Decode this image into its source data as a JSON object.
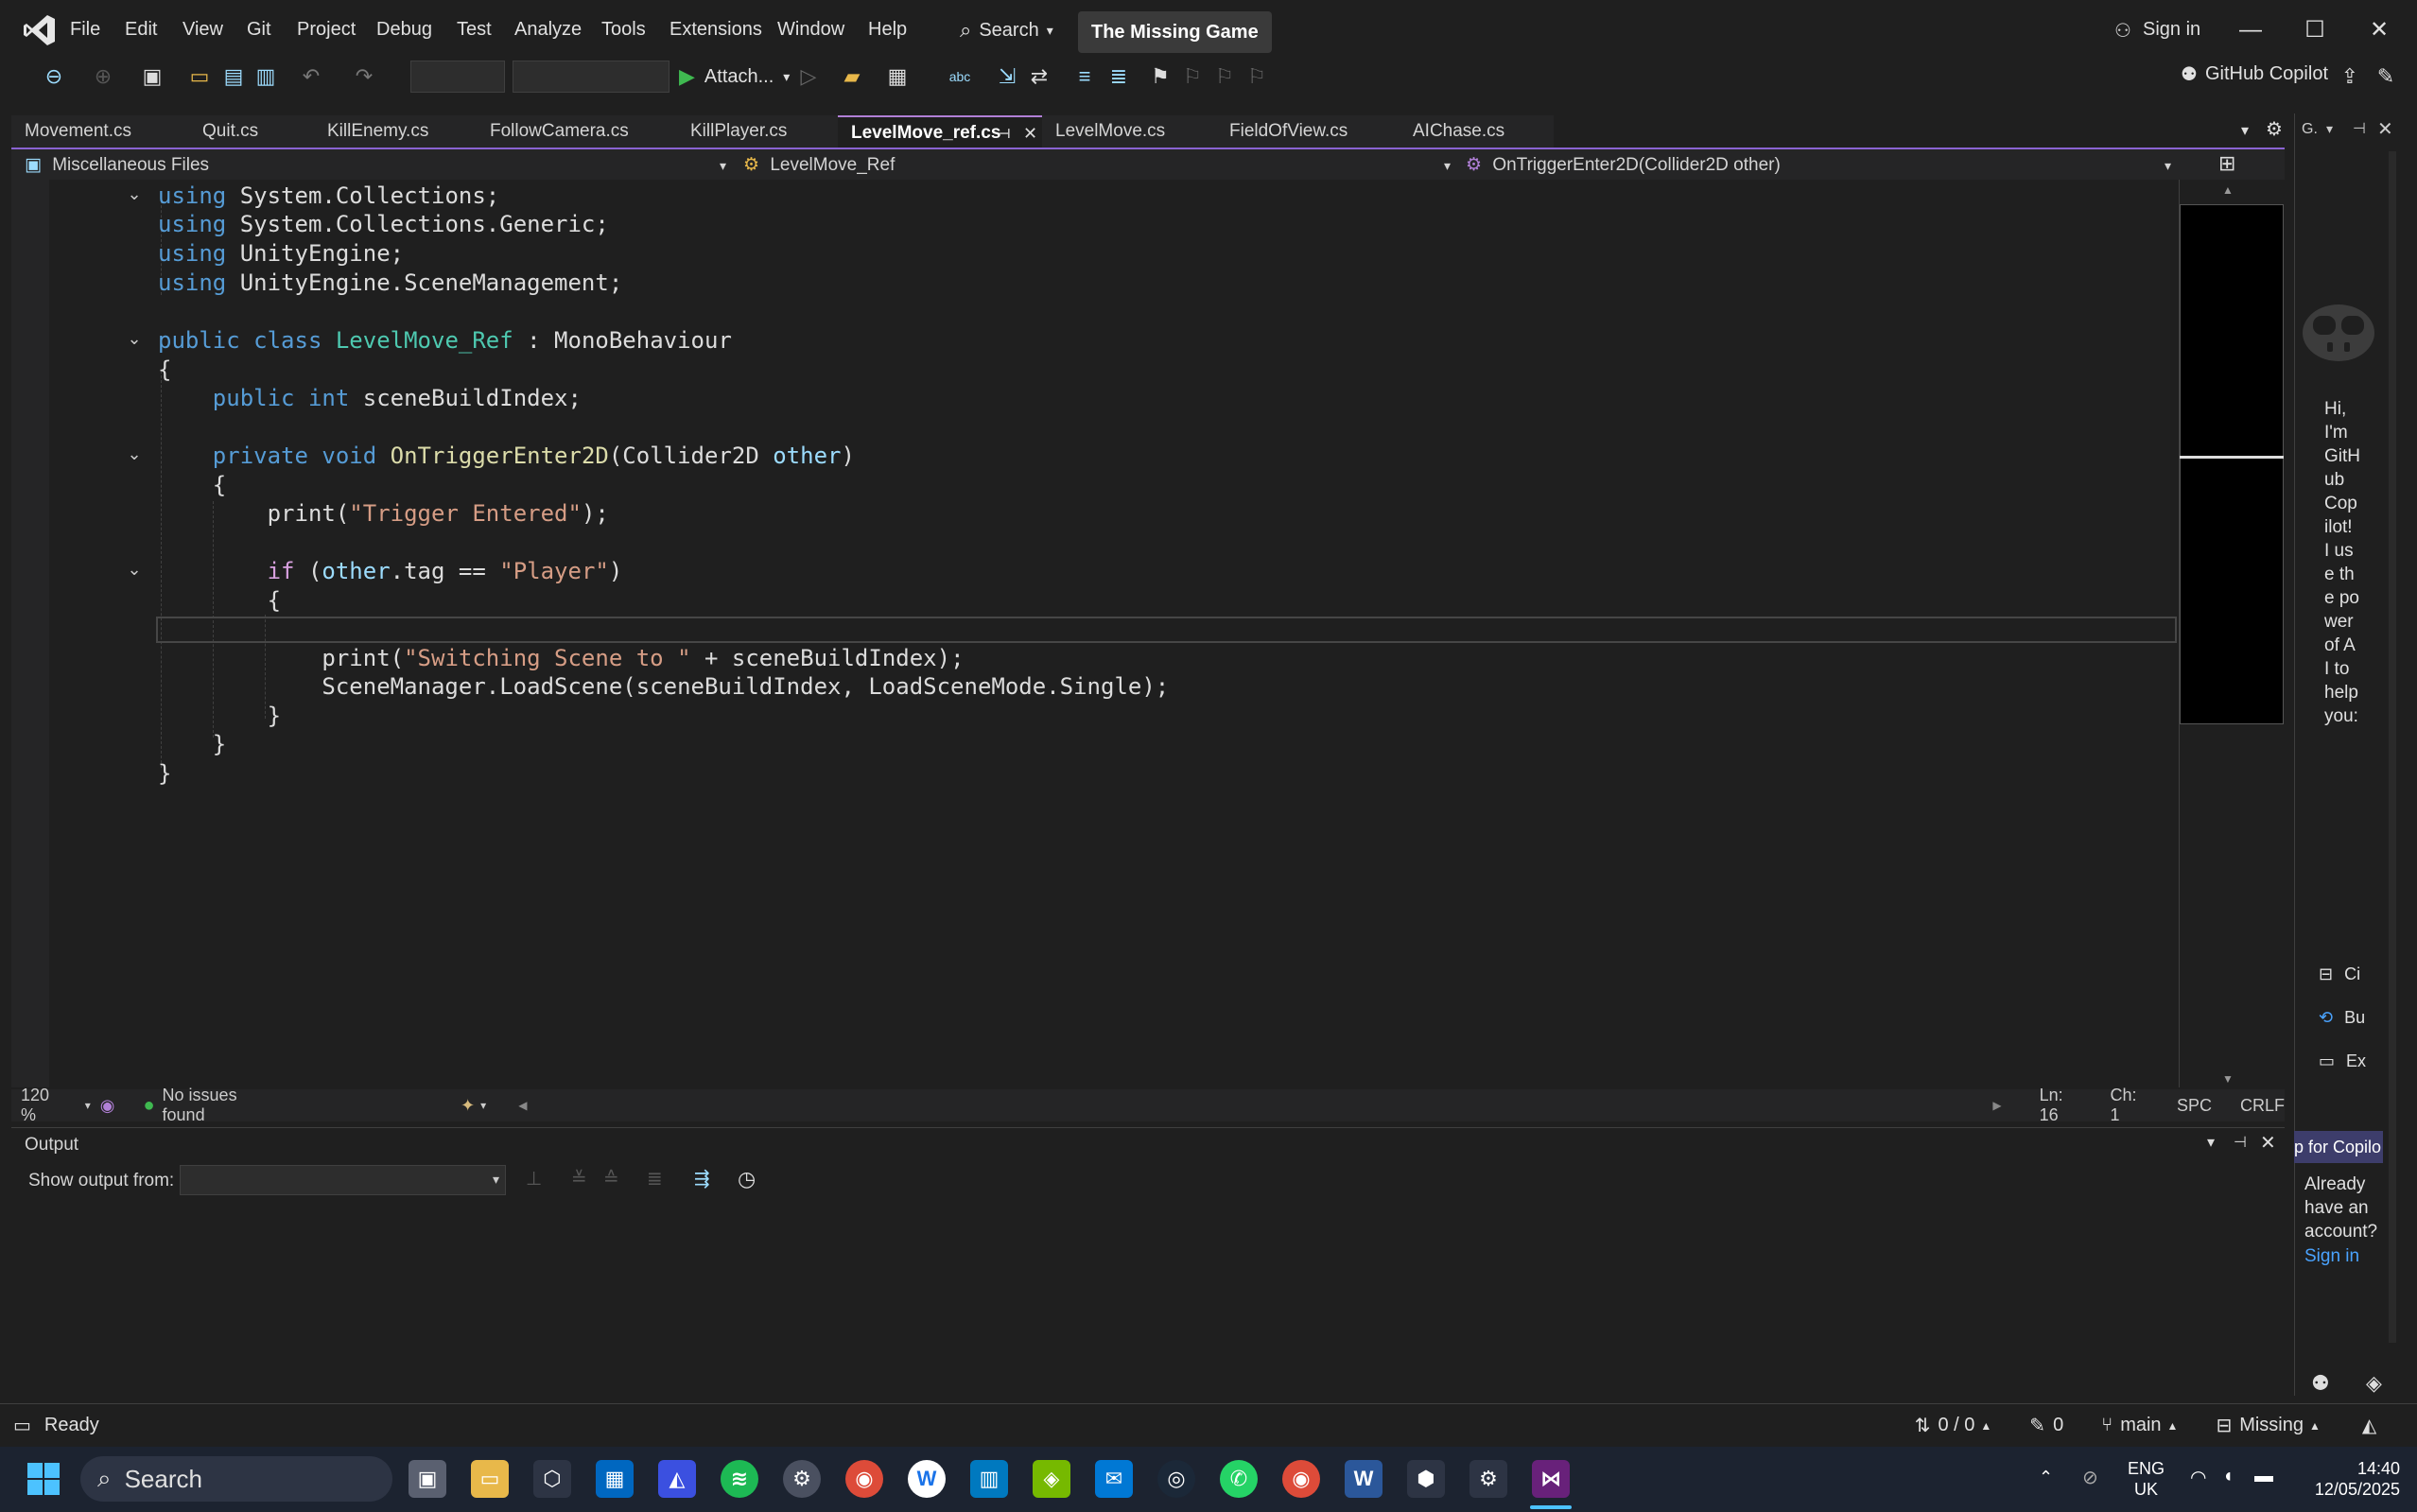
{
  "menu": [
    "File",
    "Edit",
    "View",
    "Git",
    "Project",
    "Debug",
    "Test",
    "Analyze",
    "Tools",
    "Extensions",
    "Window",
    "Help"
  ],
  "title": {
    "search_label": "Search",
    "solution_name": "The Missing Game",
    "sign_in": "Sign in"
  },
  "toolbar": {
    "attach_label": "Attach...",
    "copilot_label": "GitHub Copilot"
  },
  "tabs": [
    {
      "label": "Movement.cs",
      "active": false
    },
    {
      "label": "Quit.cs",
      "active": false
    },
    {
      "label": "KillEnemy.cs",
      "active": false
    },
    {
      "label": "FollowCamera.cs",
      "active": false
    },
    {
      "label": "KillPlayer.cs",
      "active": false
    },
    {
      "label": "LevelMove_ref.cs",
      "active": true
    },
    {
      "label": "LevelMove.cs",
      "active": false
    },
    {
      "label": "FieldOfView.cs",
      "active": false
    },
    {
      "label": "AIChase.cs",
      "active": false
    }
  ],
  "navbar": {
    "project": "Miscellaneous Files",
    "type": "LevelMove_Ref",
    "member": "OnTriggerEnter2D(Collider2D other)"
  },
  "code": {
    "lines": [
      "using System.Collections;",
      "using System.Collections.Generic;",
      "using UnityEngine;",
      "using UnityEngine.SceneManagement;",
      "",
      "public class LevelMove_Ref : MonoBehaviour",
      "{",
      "    public int sceneBuildIndex;",
      "",
      "    private void OnTriggerEnter2D(Collider2D other)",
      "    {",
      "        print(\"Trigger Entered\");",
      "",
      "        if (other.tag == \"Player\")",
      "        {",
      "",
      "            print(\"Switching Scene to \" + sceneBuildIndex);",
      "            SceneManager.LoadScene(sceneBuildIndex, LoadSceneMode.Single);",
      "        }",
      "    }",
      "}"
    ]
  },
  "editor_status": {
    "zoom": "120 %",
    "issues": "No issues found",
    "line": "Ln: 16",
    "col": "Ch: 1",
    "whitespace": "SPC",
    "line_ending": "CRLF"
  },
  "output": {
    "title": "Output",
    "show_from_label": "Show output from:"
  },
  "copilot": {
    "greeting": "Hi, I'm GitHub Copilot! I use the power of AI to help you:",
    "items": [
      "Ci",
      "Bu",
      "Ex"
    ],
    "signup_label": "p for Copilo",
    "already": "Already have an account?",
    "sign_in": "Sign in"
  },
  "statusbar": {
    "ready": "Ready",
    "changes": "0 / 0",
    "edits": "0",
    "branch": "main",
    "repo": "Missing"
  },
  "taskbar": {
    "search": "Search",
    "lang_top": "ENG",
    "lang_bottom": "UK",
    "time": "14:40",
    "date": "12/05/2025"
  },
  "colors": {
    "accent": "#8a63d2",
    "keyword": "#569cd6",
    "type": "#4ec9b0",
    "string": "#d69d85"
  }
}
